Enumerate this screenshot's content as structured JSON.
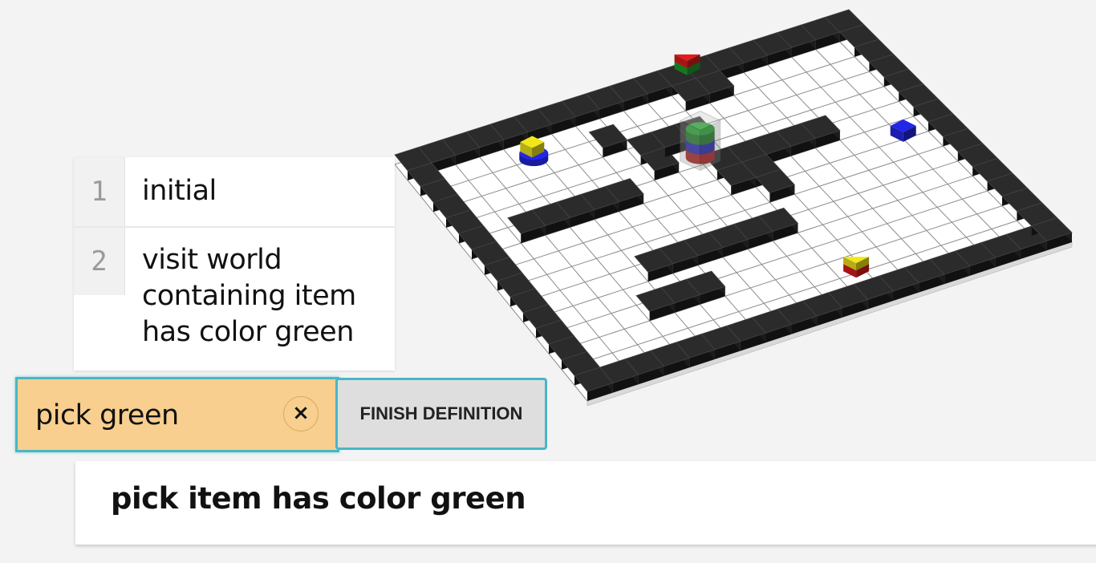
{
  "history": [
    {
      "number": "1",
      "text": "initial"
    },
    {
      "number": "2",
      "text": "visit world containing item has color green"
    }
  ],
  "command": {
    "value": "pick green",
    "clear_label": "×",
    "finish_label": "FINISH DEFINITION"
  },
  "suggestion": {
    "text": "pick item has color green"
  },
  "world": {
    "wall_color": "#2b2b2b",
    "floor_color": "#ffffff",
    "grid_color": "#8c8c8c",
    "items": [
      {
        "name": "yellow-blue-stack",
        "colors": [
          "blue",
          "yellow"
        ]
      },
      {
        "name": "red-green-stack",
        "colors": [
          "green",
          "red"
        ]
      },
      {
        "name": "robot-stack",
        "colors": [
          "red",
          "blue",
          "green"
        ]
      },
      {
        "name": "blue-block",
        "colors": [
          "blue"
        ]
      },
      {
        "name": "red-yellow-stack",
        "colors": [
          "red",
          "yellow"
        ]
      }
    ]
  }
}
